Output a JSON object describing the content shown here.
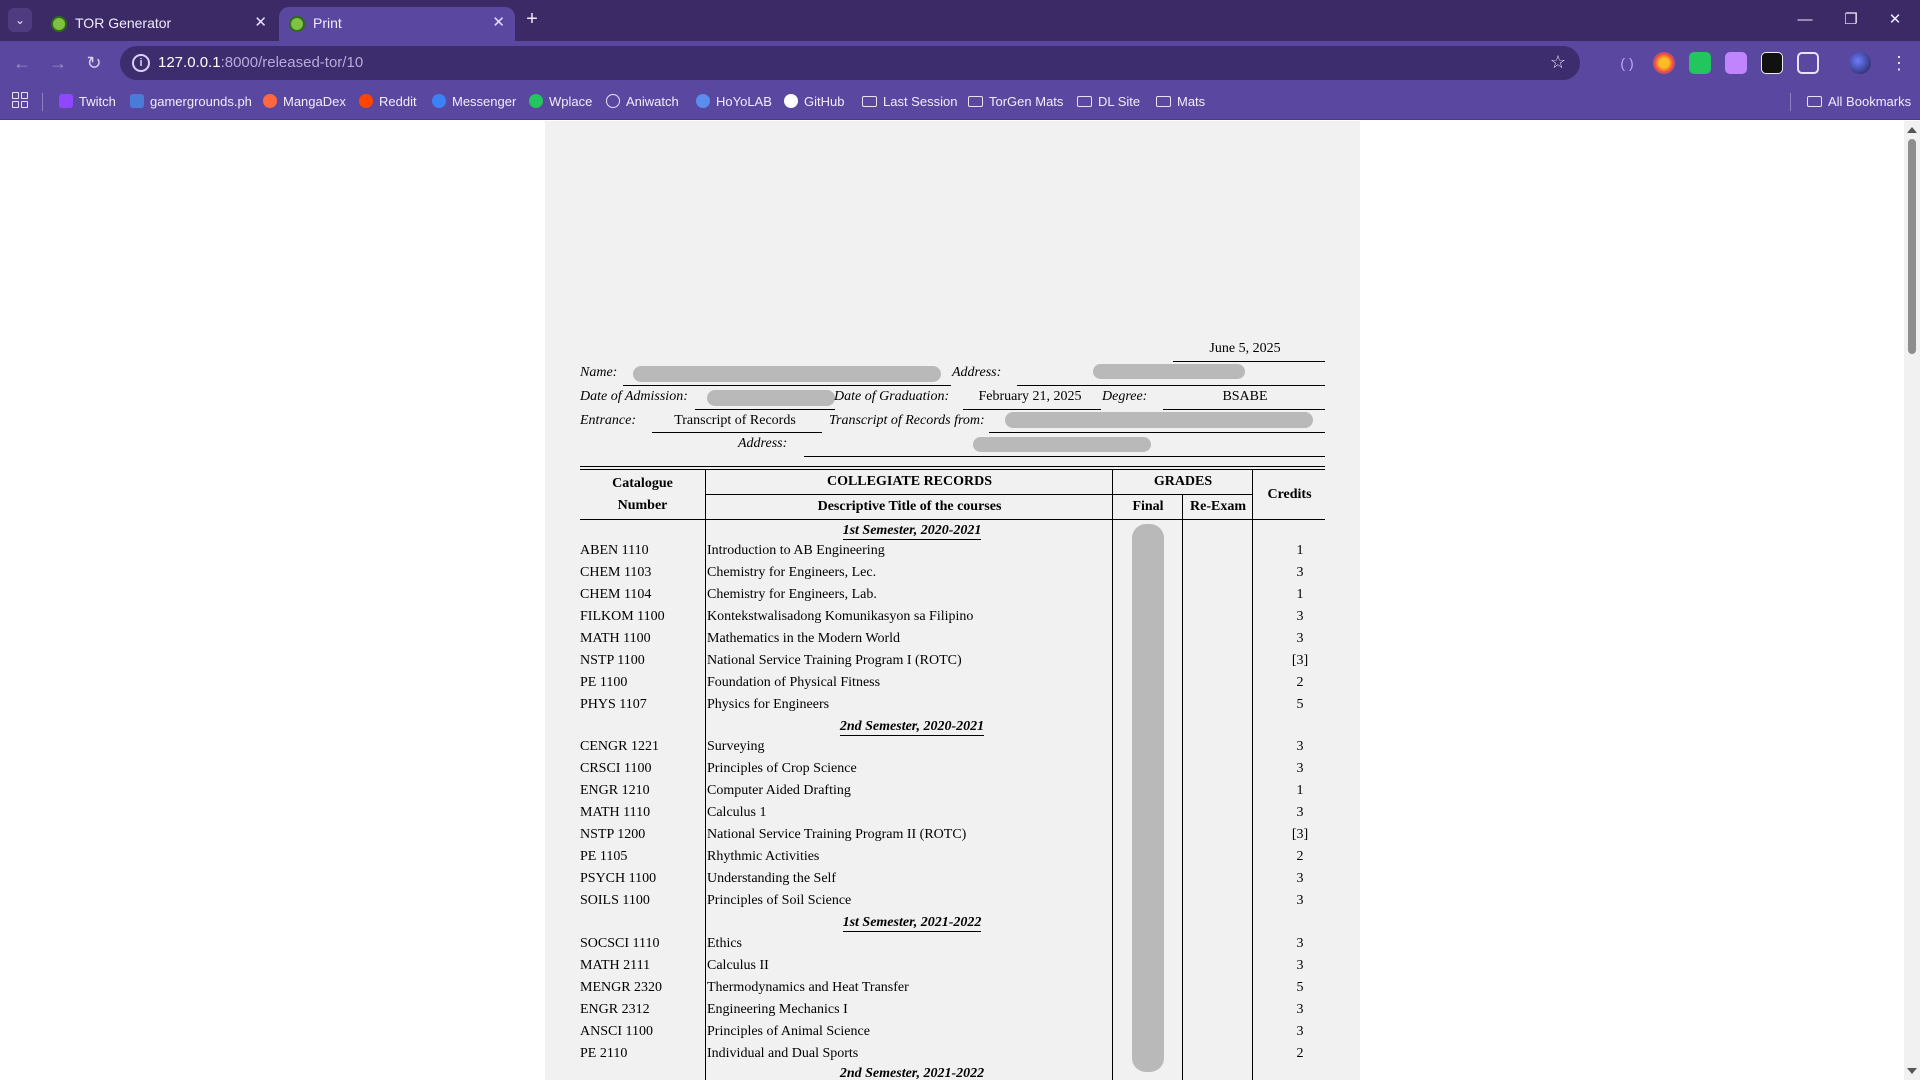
{
  "browser": {
    "tabs": [
      {
        "title": "TOR Generator",
        "active": false
      },
      {
        "title": "Print",
        "active": true
      }
    ],
    "new_tab": "+",
    "address": {
      "host": "127.0.0.1",
      "path": ":8000/released-tor/10"
    },
    "bookmarks": [
      {
        "label": "Twitch",
        "icon": "twitch-icon",
        "color": "#9146ff"
      },
      {
        "label": "gamergrounds.ph",
        "icon": "gamergrounds-icon",
        "color": "#4a7bd8"
      },
      {
        "label": "MangaDex",
        "icon": "mangadex-icon",
        "color": "#ff6740"
      },
      {
        "label": "Reddit",
        "icon": "reddit-icon",
        "color": "#ff4500"
      },
      {
        "label": "Messenger",
        "icon": "messenger-icon",
        "color": "#3b82f6"
      },
      {
        "label": "Wplace",
        "icon": "wplace-icon",
        "color": "#22c55e"
      },
      {
        "label": "Aniwatch",
        "icon": "aniwatch-icon",
        "color": "#e9e2ff"
      },
      {
        "label": "HoYoLAB",
        "icon": "hoyolab-icon",
        "color": "#5b8def"
      },
      {
        "label": "GitHub",
        "icon": "github-icon",
        "color": "#ffffff"
      },
      {
        "label": "Last Session",
        "icon": "folder-icon",
        "color": ""
      },
      {
        "label": "TorGen Mats",
        "icon": "folder-icon",
        "color": ""
      },
      {
        "label": "DL Site",
        "icon": "folder-icon",
        "color": ""
      },
      {
        "label": "Mats",
        "icon": "folder-icon",
        "color": ""
      }
    ],
    "all_bookmarks": "All Bookmarks"
  },
  "document": {
    "date": "June 5, 2025",
    "labels": {
      "name": "Name:",
      "address": "Address:",
      "date_admission": "Date of Admission:",
      "date_graduation": "Date of Graduation:",
      "degree": "Degree:",
      "entrance": "Entrance:",
      "tor_from": "Transcript of Records from:",
      "address2": "Address:"
    },
    "values": {
      "date_graduation": "February 21, 2025",
      "degree": "BSABE",
      "entrance": "Transcript of Records"
    },
    "table_headers": {
      "catalogue_1": "Catalogue",
      "catalogue_2": "Number",
      "collegiate": "COLLEGIATE RECORDS",
      "descriptive": "Descriptive Title of the courses",
      "grades": "GRADES",
      "final": "Final",
      "reexam": "Re-Exam",
      "credits": "Credits"
    },
    "semesters": [
      {
        "title": "1st Semester, 2020-2021",
        "courses": [
          {
            "code": "ABEN 1110",
            "title": "Introduction to AB Engineering",
            "credits": "1"
          },
          {
            "code": "CHEM 1103",
            "title": "Chemistry for Engineers, Lec.",
            "credits": "3"
          },
          {
            "code": "CHEM 1104",
            "title": "Chemistry for Engineers, Lab.",
            "credits": "1"
          },
          {
            "code": "FILKOM 1100",
            "title": "Kontekstwalisadong Komunikasyon sa Filipino",
            "credits": "3"
          },
          {
            "code": "MATH 1100",
            "title": "Mathematics in the Modern World",
            "credits": "3"
          },
          {
            "code": "NSTP 1100",
            "title": "National Service Training Program I (ROTC)",
            "credits": "[3]"
          },
          {
            "code": "PE 1100",
            "title": "Foundation of Physical Fitness",
            "credits": "2"
          },
          {
            "code": "PHYS 1107",
            "title": "Physics for Engineers",
            "credits": "5"
          }
        ]
      },
      {
        "title": "2nd Semester, 2020-2021",
        "courses": [
          {
            "code": "CENGR 1221",
            "title": "Surveying",
            "credits": "3"
          },
          {
            "code": "CRSCI 1100",
            "title": "Principles of Crop Science",
            "credits": "3"
          },
          {
            "code": "ENGR 1210",
            "title": "Computer Aided Drafting",
            "credits": "1"
          },
          {
            "code": "MATH 1110",
            "title": "Calculus 1",
            "credits": "3"
          },
          {
            "code": "NSTP 1200",
            "title": "National Service Training Program II (ROTC)",
            "credits": "[3]"
          },
          {
            "code": "PE 1105",
            "title": "Rhythmic Activities",
            "credits": "2"
          },
          {
            "code": "PSYCH 1100",
            "title": "Understanding the Self",
            "credits": "3"
          },
          {
            "code": "SOILS 1100",
            "title": "Principles of Soil Science",
            "credits": "3"
          }
        ]
      },
      {
        "title": "1st Semester, 2021-2022",
        "courses": [
          {
            "code": "SOCSCI 1110",
            "title": "Ethics",
            "credits": "3"
          },
          {
            "code": "MATH 2111",
            "title": "Calculus II",
            "credits": "3"
          },
          {
            "code": "MENGR 2320",
            "title": "Thermodynamics and Heat Transfer",
            "credits": "5"
          },
          {
            "code": "ENGR 2312",
            "title": "Engineering Mechanics I",
            "credits": "3"
          },
          {
            "code": "ANSCI 1100",
            "title": "Principles of Animal Science",
            "credits": "3"
          },
          {
            "code": "PE 2110",
            "title": "Individual and Dual Sports",
            "credits": "2"
          }
        ]
      },
      {
        "title": "2nd Semester, 2021-2022",
        "courses": []
      }
    ]
  }
}
